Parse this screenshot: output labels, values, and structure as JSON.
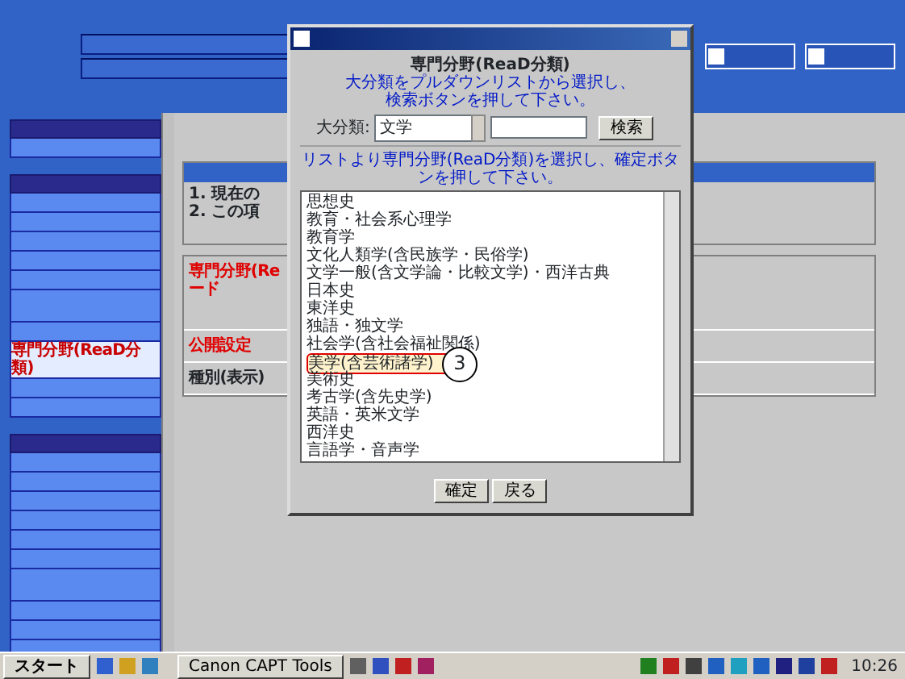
{
  "sidebar": {
    "groups": [
      {
        "items": [
          {
            "selected": false
          }
        ]
      },
      {
        "items": [
          {
            "selected": false
          },
          {
            "selected": false
          },
          {
            "selected": false
          },
          {
            "selected": false
          },
          {
            "selected": false
          },
          {
            "selected": false,
            "tall": true
          },
          {
            "selected": false
          },
          {
            "selected": true,
            "label": "専門分野(ReaD分類)"
          },
          {
            "selected": false
          },
          {
            "selected": false
          }
        ]
      },
      {
        "items": [
          {
            "selected": false
          },
          {
            "selected": false
          },
          {
            "selected": false
          },
          {
            "selected": false
          },
          {
            "selected": false
          },
          {
            "selected": false
          },
          {
            "selected": false,
            "tall": true
          },
          {
            "selected": false
          },
          {
            "selected": false
          },
          {
            "selected": false
          }
        ]
      }
    ]
  },
  "notice": {
    "lines": [
      "1. 現在の",
      "2. この項"
    ]
  },
  "form": {
    "rows": [
      {
        "kind": "required",
        "lines": [
          "専門分野(Re",
          "ード"
        ]
      },
      {
        "kind": "required",
        "lines": [
          "公開設定"
        ]
      },
      {
        "kind": "normal",
        "lines": [
          "種別(表示)"
        ]
      }
    ]
  },
  "dialog": {
    "title": "専門分野(ReaD分類)",
    "instructions": [
      "大分類をプルダウンリストから選択し、",
      "検索ボタンを押して下さい。"
    ],
    "category_label": "大分類:",
    "category_value": "文学",
    "search_button": "検索",
    "list_instruction": "リストより専門分野(ReaD分類)を選択し、確定ボタンを押して下さい。",
    "items": [
      {
        "label": "思想史",
        "marked": false
      },
      {
        "label": "教育・社会系心理学",
        "marked": false
      },
      {
        "label": "教育学",
        "marked": false
      },
      {
        "label": "文化人類学(含民族学・民俗学)",
        "marked": false
      },
      {
        "label": "文学一般(含文学論・比較文学)・西洋古典",
        "marked": false
      },
      {
        "label": "日本史",
        "marked": false
      },
      {
        "label": "東洋史",
        "marked": false
      },
      {
        "label": "独語・独文学",
        "marked": false
      },
      {
        "label": "社会学(含社会福祉関係)",
        "marked": false
      },
      {
        "label": "美学(含芸術諸学)",
        "marked": true
      },
      {
        "label": "美術史",
        "marked": false
      },
      {
        "label": "考古学(含先史学)",
        "marked": false
      },
      {
        "label": "英語・英米文学",
        "marked": false
      },
      {
        "label": "西洋史",
        "marked": false
      },
      {
        "label": "言語学・音声学",
        "marked": false
      }
    ],
    "annotation": "3",
    "buttons": [
      "確定",
      "戻る"
    ]
  },
  "taskbar": {
    "start": "スタート",
    "task": "Canon CAPT Tools",
    "clock": "10:26"
  }
}
